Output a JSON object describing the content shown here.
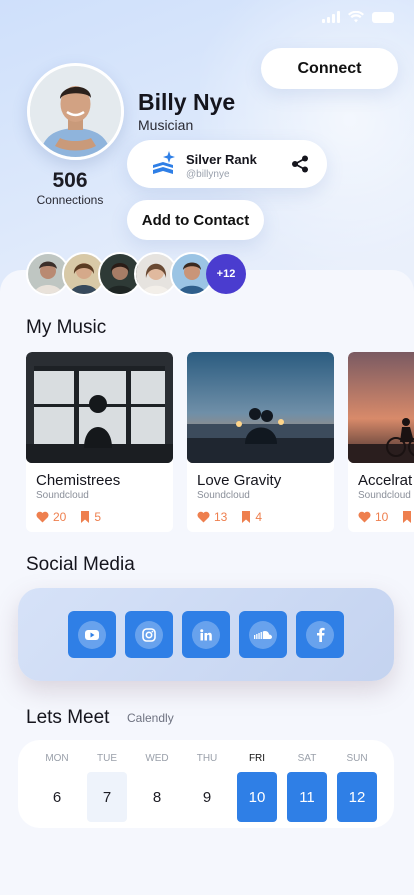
{
  "profile": {
    "name": "Billy Nye",
    "role": "Musician",
    "connections_count": "506",
    "connections_label": "Connections",
    "rank_title": "Silver Rank",
    "handle": "@billynye"
  },
  "actions": {
    "connect_label": "Connect",
    "add_contact_label": "Add to Contact"
  },
  "friends": {
    "more_label": "+12"
  },
  "music": {
    "section_title": "My Music",
    "items": [
      {
        "title": "Chemistrees",
        "source": "Soundcloud",
        "likes": "20",
        "saves": "5"
      },
      {
        "title": "Love Gravity",
        "source": "Soundcloud",
        "likes": "13",
        "saves": "4"
      },
      {
        "title": "Accelrat",
        "source": "Soundcloud",
        "likes": "10",
        "saves": ""
      }
    ]
  },
  "social": {
    "section_title": "Social Media",
    "icons": [
      "youtube-icon",
      "instagram-icon",
      "linkedin-icon",
      "soundcloud-icon",
      "facebook-icon"
    ]
  },
  "meet": {
    "section_title": "Lets Meet",
    "subtitle": "Calendly",
    "days": [
      {
        "name": "MON",
        "num": "6"
      },
      {
        "name": "TUE",
        "num": "7"
      },
      {
        "name": "WED",
        "num": "8"
      },
      {
        "name": "THU",
        "num": "9"
      },
      {
        "name": "FRI",
        "num": "10"
      },
      {
        "name": "SAT",
        "num": "11"
      },
      {
        "name": "SUN",
        "num": "12"
      }
    ]
  },
  "colors": {
    "accent": "#2f7fe6",
    "stat": "#ee7f4e",
    "badge": "#4a3ccf"
  }
}
